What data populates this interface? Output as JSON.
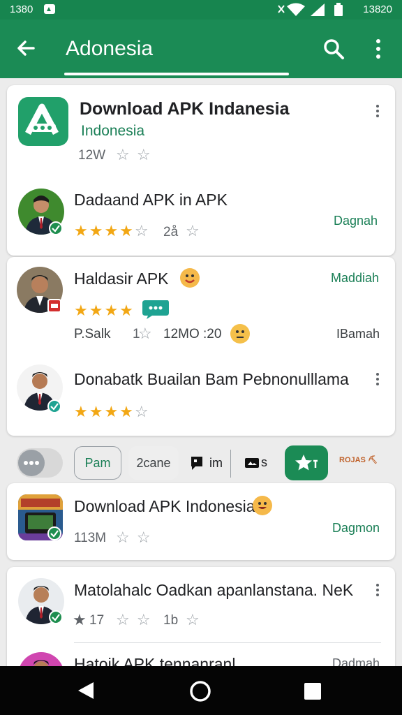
{
  "status_bar": {
    "time": "1380",
    "clock": "13820"
  },
  "app_bar": {
    "title": "Adonesia"
  },
  "featured": {
    "title": "Download APK Indanesia",
    "subtitle": "Indonesia",
    "meta": "12W"
  },
  "items": [
    {
      "title": "Dadaand APK in APK",
      "meta": "2å",
      "right": "Dagnah"
    },
    {
      "title": "Haldasir APK",
      "meta1": "P.Salk",
      "meta2": "1",
      "meta3": "12MO :20",
      "right": "Maddiah",
      "right2": "IBamah"
    },
    {
      "title": "Donabatk Buailan Bam Pebnonulllama"
    },
    {
      "title": "Download APK Indonesia",
      "meta": "113M",
      "right": "Dagmon"
    },
    {
      "title": "Matolahalc Oadkan apanlanstana. NeK",
      "meta": "17",
      "meta2": "1b"
    },
    {
      "title": "Hatoik APK tennanranl",
      "right": "Dadmah"
    }
  ],
  "chips": {
    "pam": "Pam",
    "acane": "2cane",
    "im": "im",
    "s": "s",
    "tail": "ROJAS ⛏"
  },
  "colors": {
    "primary": "#1b8b55",
    "accent_text": "#1a7f56",
    "star": "#f2a714"
  }
}
